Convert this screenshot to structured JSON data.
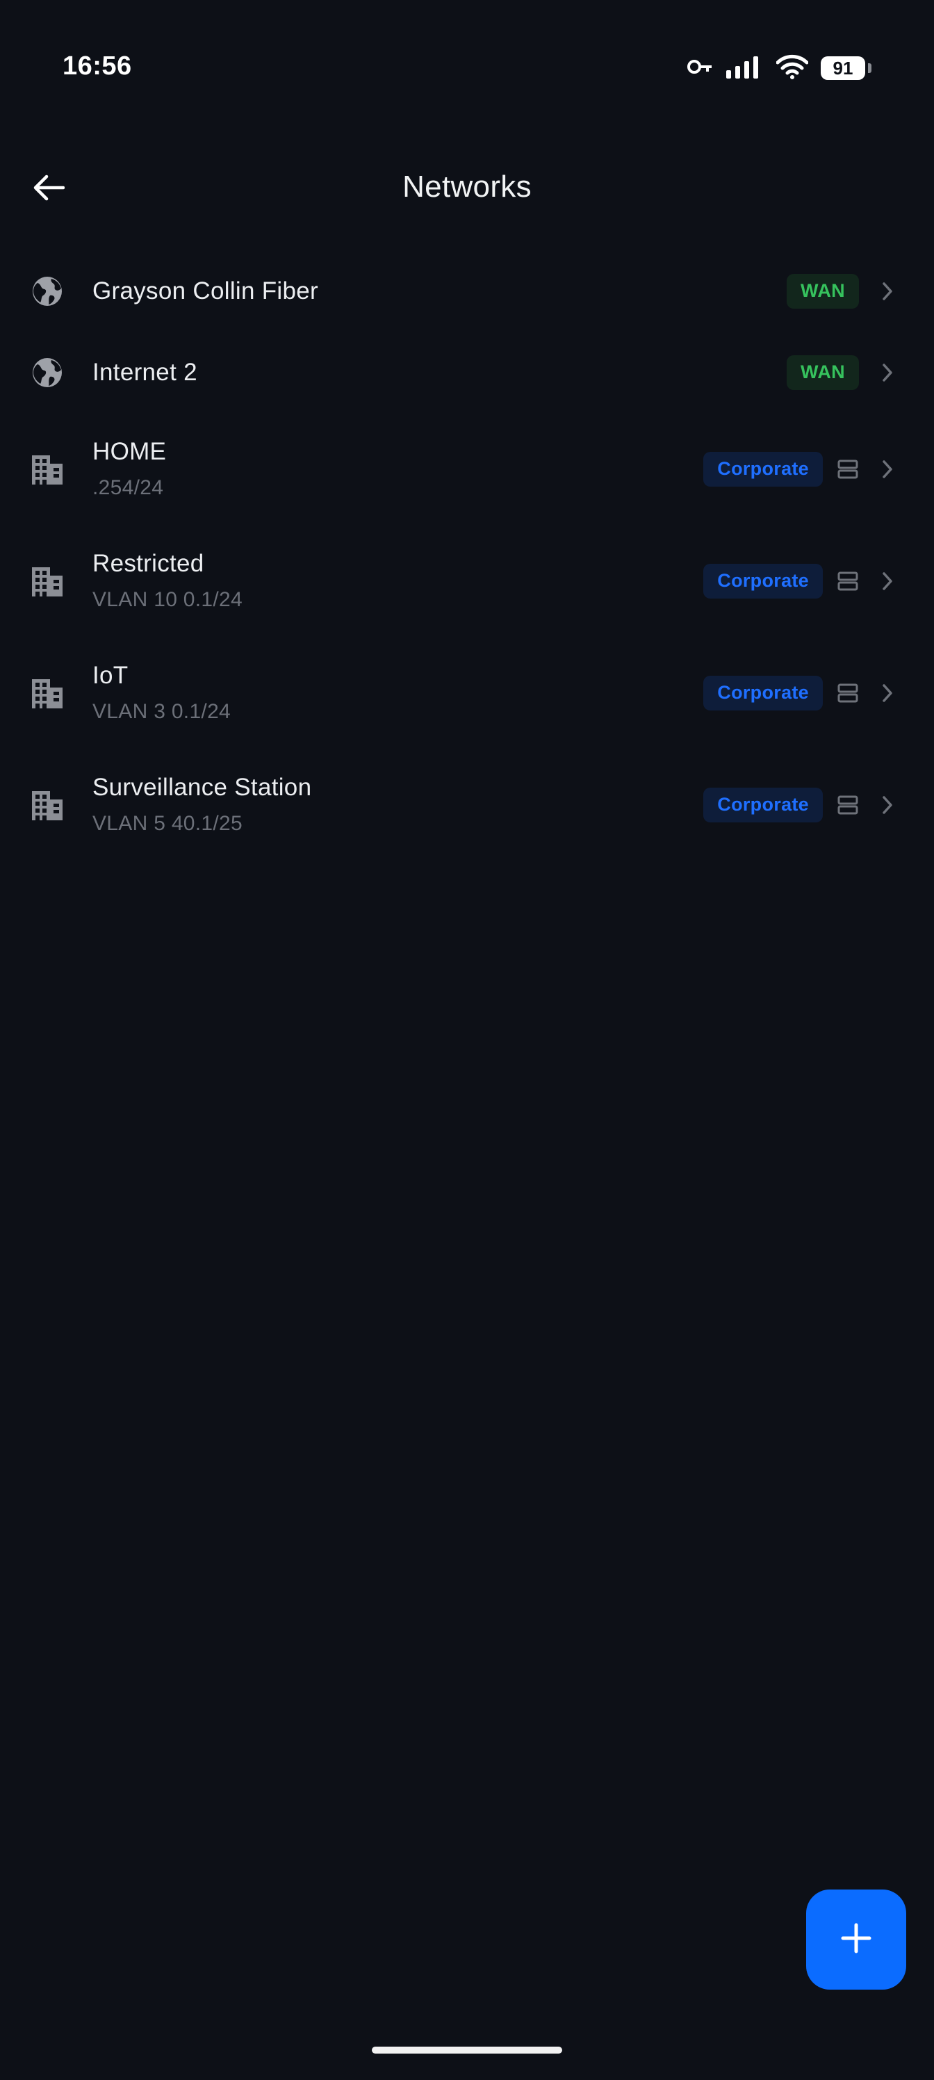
{
  "status_bar": {
    "time": "16:56",
    "battery": "91",
    "icons": [
      "vpn-key-icon",
      "cellular-signal-icon",
      "wifi-icon",
      "battery-icon"
    ]
  },
  "header": {
    "title": "Networks",
    "back_icon": "arrow-left-icon"
  },
  "networks": [
    {
      "name": "Grayson Collin Fiber",
      "subtitle": "",
      "badge": "WAN",
      "icon": "globe-icon"
    },
    {
      "name": "Internet 2",
      "subtitle": "",
      "badge": "WAN",
      "icon": "globe-icon"
    },
    {
      "name": "HOME",
      "subtitle": ".254/24",
      "badge": "Corporate",
      "icon": "building-icon"
    },
    {
      "name": "Restricted",
      "subtitle": "VLAN 10 0.1/24",
      "badge": "Corporate",
      "icon": "building-icon"
    },
    {
      "name": "IoT",
      "subtitle": "VLAN 3 0.1/24",
      "badge": "Corporate",
      "icon": "building-icon"
    },
    {
      "name": "Surveillance Station",
      "subtitle": "VLAN 5 40.1/25",
      "badge": "Corporate",
      "icon": "building-icon"
    }
  ],
  "fab": {
    "icon": "plus-icon"
  },
  "colors": {
    "background": "#0d1017",
    "wan_text": "#36c25d",
    "wan_bg": "#12261c",
    "corporate_text": "#1f6fff",
    "corporate_bg": "#0e1d3a",
    "fab": "#0b6cff"
  }
}
